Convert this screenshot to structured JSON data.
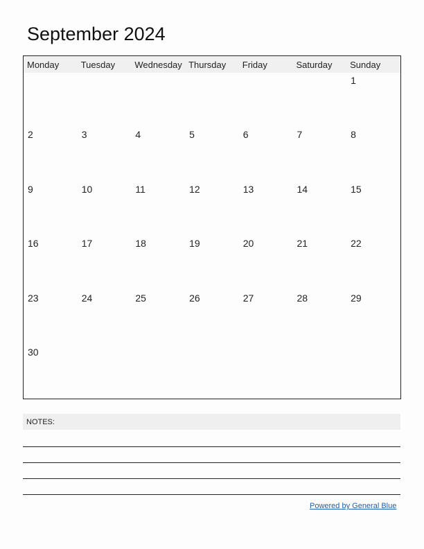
{
  "title": "September 2024",
  "weekdays": [
    "Monday",
    "Tuesday",
    "Wednesday",
    "Thursday",
    "Friday",
    "Saturday",
    "Sunday"
  ],
  "weeks": [
    [
      "",
      "",
      "",
      "",
      "",
      "",
      "1"
    ],
    [
      "2",
      "3",
      "4",
      "5",
      "6",
      "7",
      "8"
    ],
    [
      "9",
      "10",
      "11",
      "12",
      "13",
      "14",
      "15"
    ],
    [
      "16",
      "17",
      "18",
      "19",
      "20",
      "21",
      "22"
    ],
    [
      "23",
      "24",
      "25",
      "26",
      "27",
      "28",
      "29"
    ],
    [
      "30",
      "",
      "",
      "",
      "",
      "",
      ""
    ]
  ],
  "notes": {
    "label": "NOTES:"
  },
  "footer": {
    "powered_by": "Powered by General Blue",
    "link_color": "#1a5fb4"
  }
}
